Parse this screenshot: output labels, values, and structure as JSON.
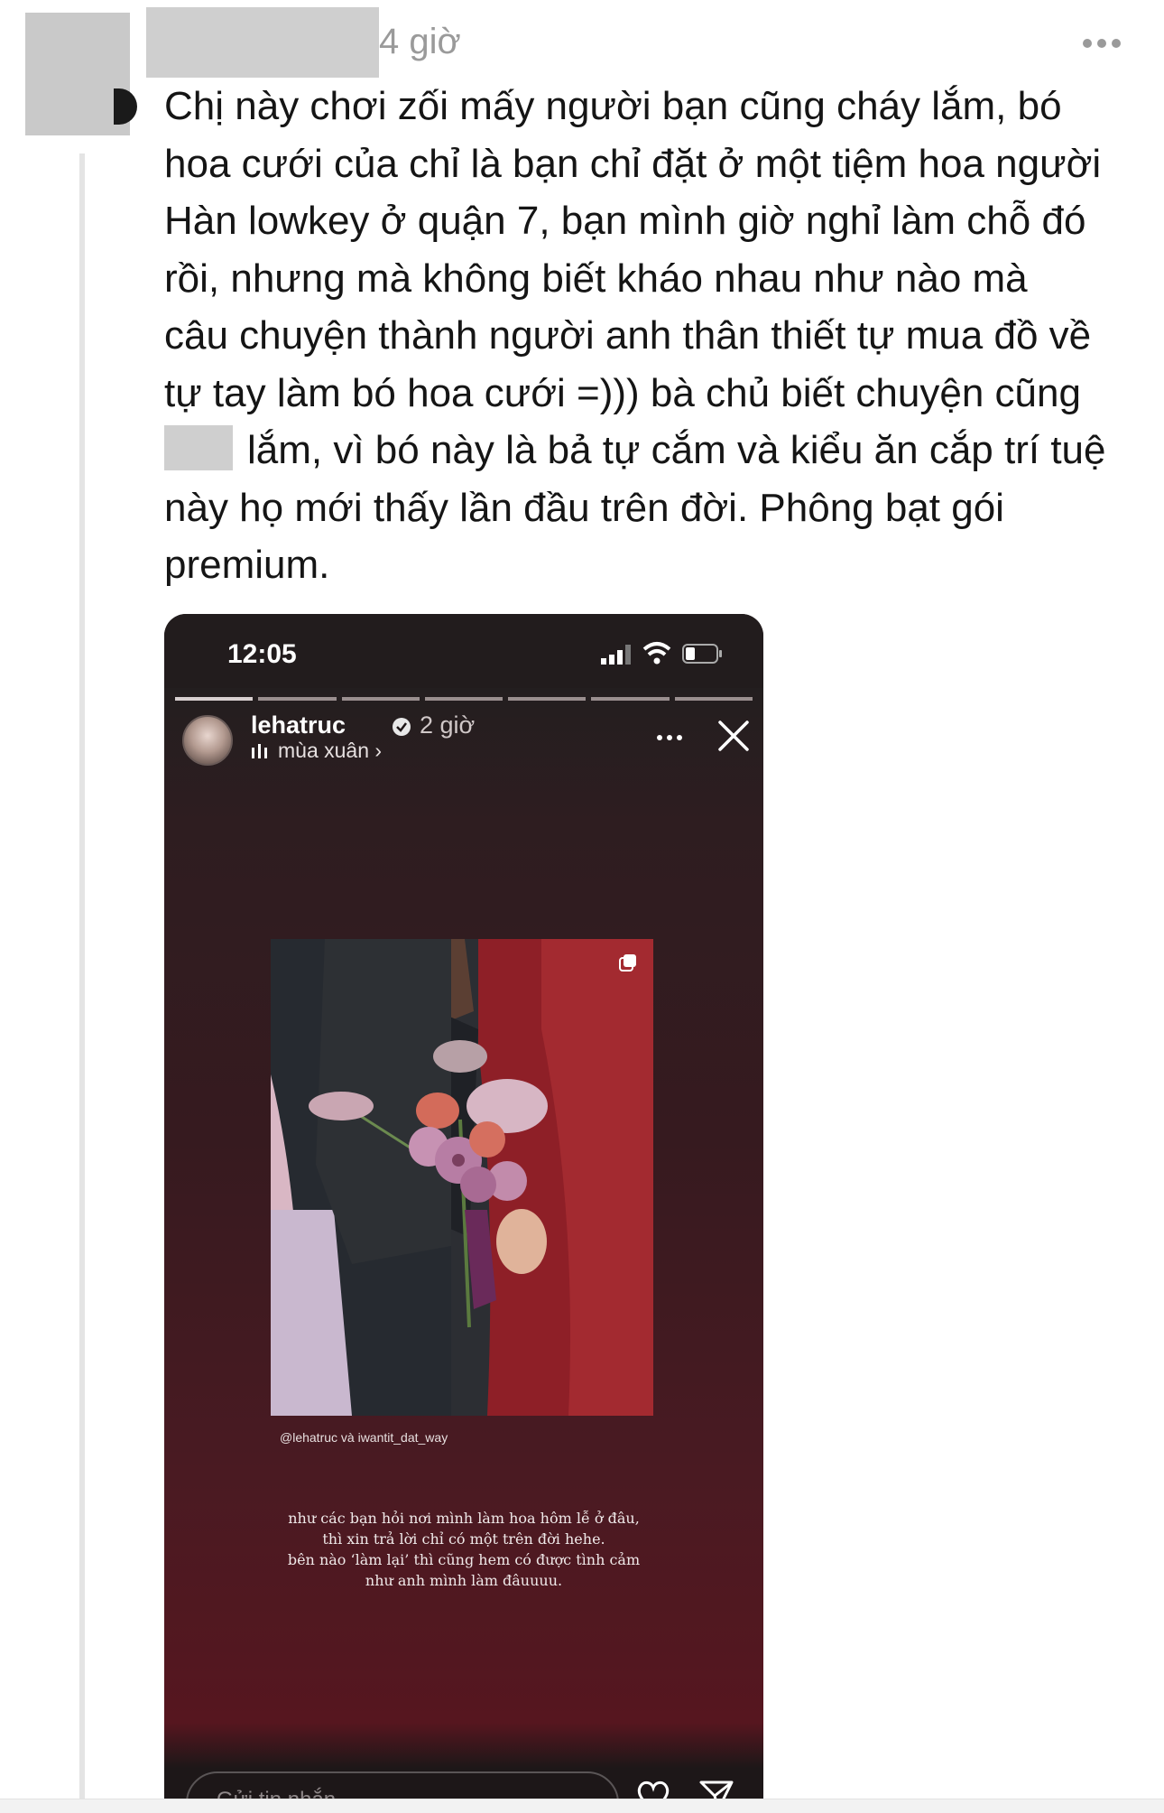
{
  "post": {
    "timestamp": "4 giờ",
    "comment_lines": [
      "Chị này chơi zối mấy người bạn cũng cháy lắm, bó",
      "hoa cưới của chỉ là bạn chỉ đặt ở một tiệm hoa người",
      "Hàn lowkey ở quận 7, bạn mình giờ nghỉ làm chỗ đó",
      "rồi, nhưng mà không biết kháo nhau như nào mà",
      "câu chuyện thành người anh thân thiết tự mua đồ về",
      "tự tay làm bó hoa cưới =))) bà chủ biết chuyện cũng",
      "lắm, vì bó này là bả tự cắm và kiểu ăn cắp trí tuệ",
      "này họ mới thấy lần đầu trên đời. Phông bạt gói",
      "premium."
    ]
  },
  "story": {
    "status_time": "12:05",
    "username": "lehatruc",
    "time_ago": "2 giờ",
    "music": "mùa xuân ›",
    "mention": "@lehatruc và iwantit_dat_way",
    "caption_lines": [
      "như các bạn hỏi nơi mình làm hoa hôm lễ ở đâu,",
      "thì xin trả lời chỉ có một trên đời hehe.",
      "bên nào ‘làm lại’ thì cũng hem có được tình cảm",
      "như anh mình làm đâuuuu."
    ],
    "reply_placeholder": "Gửi tin nhắn",
    "progress_segments": 7
  },
  "colors": {
    "timestamp": "#9a9a9a",
    "story_bg_top": "#231e1f",
    "story_bg_bottom": "#56161f",
    "redaction": "#cfcfcf"
  },
  "icons": [
    "more-icon",
    "signal-icon",
    "wifi-icon",
    "battery-icon",
    "verified-icon",
    "music-icon",
    "more-icon",
    "close-icon",
    "multi-image-icon",
    "heart-icon",
    "send-icon"
  ]
}
